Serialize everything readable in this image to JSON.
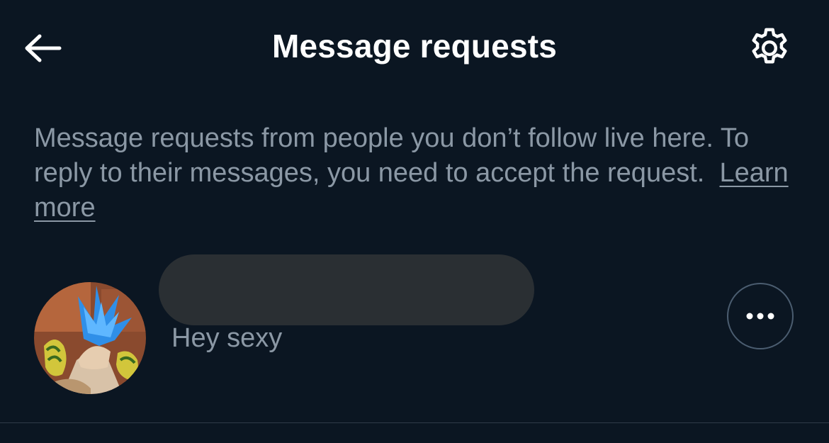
{
  "header": {
    "title": "Message requests",
    "back_icon": "arrow-left-icon",
    "settings_icon": "gear-icon"
  },
  "info": {
    "text": "Message requests from people you don’t follow live here. To reply to their messages, you need to accept the request.",
    "learn_more": "Learn more"
  },
  "requests": [
    {
      "avatar": "anime-character-avatar",
      "name": "",
      "message": "Hey sexy",
      "more_icon": "more-horizontal-icon"
    }
  ],
  "colors": {
    "background": "#0b1622",
    "text_primary": "#ffffff",
    "text_secondary": "#8b98a5",
    "redaction": "#2a2f33",
    "button_border": "#4b5d70"
  }
}
